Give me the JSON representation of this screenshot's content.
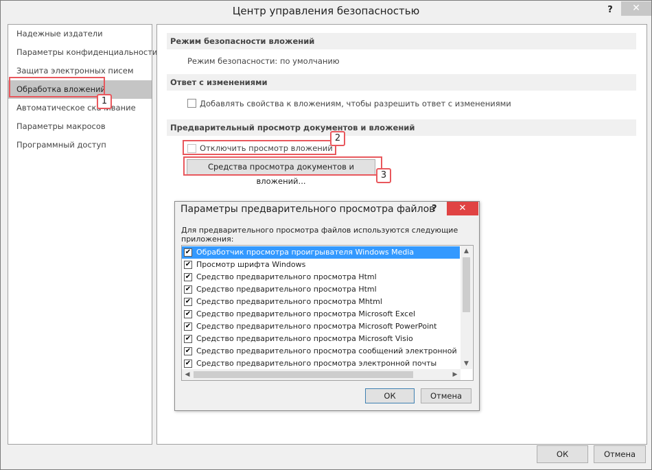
{
  "window": {
    "title": "Центр управления безопасностью",
    "help": "?",
    "close": "✕"
  },
  "sidebar": {
    "items": [
      {
        "label": "Надежные издатели"
      },
      {
        "label": "Параметры конфиденциальности"
      },
      {
        "label": "Защита электронных писем"
      },
      {
        "label": "Обработка вложений",
        "selected": true
      },
      {
        "label": "Автоматическое скачивание"
      },
      {
        "label": "Параметры макросов"
      },
      {
        "label": "Программный доступ"
      }
    ]
  },
  "main": {
    "section1": {
      "header": "Режим безопасности вложений",
      "text": "Режим безопасности: по умолчанию"
    },
    "section2": {
      "header": "Ответ с изменениями",
      "checkbox_label": "Добавлять свойства к вложениям, чтобы разрешить ответ с изменениями",
      "checked": false
    },
    "section3": {
      "header": "Предварительный просмотр документов и вложений",
      "checkbox_label": "Отключить просмотр вложений",
      "checked": false,
      "button_label": "Средства просмотра документов и вложений..."
    }
  },
  "annotations": {
    "badge1": "1",
    "badge2": "2",
    "badge3": "3",
    "color": "#e8575c"
  },
  "dialog": {
    "title": "Параметры предварительного просмотра файлов",
    "help": "?",
    "close": "✕",
    "description": "Для предварительного просмотра файлов используются следующие приложения:",
    "items": [
      {
        "label": "Обработчик просмотра проигрывателя Windows Media",
        "checked": true,
        "selected": true
      },
      {
        "label": "Просмотр шрифта Windows",
        "checked": true
      },
      {
        "label": "Средство предварительного просмотра Html",
        "checked": true
      },
      {
        "label": "Средство предварительного просмотра Html",
        "checked": true
      },
      {
        "label": "Средство предварительного просмотра Mhtml",
        "checked": true
      },
      {
        "label": "Средство предварительного просмотра Microsoft Excel",
        "checked": true
      },
      {
        "label": "Средство предварительного просмотра Microsoft PowerPoint",
        "checked": true
      },
      {
        "label": "Средство предварительного просмотра Microsoft Visio",
        "checked": true
      },
      {
        "label": "Средство предварительного просмотра сообщений электронной почты",
        "checked": true
      },
      {
        "label": "Средство предварительного просмотра электронной почты",
        "checked": true
      }
    ],
    "ok_label": "ОК",
    "cancel_label": "Отмена",
    "check_glyph": "✔"
  },
  "footer": {
    "ok_label": "ОК",
    "cancel_label": "Отмена"
  }
}
